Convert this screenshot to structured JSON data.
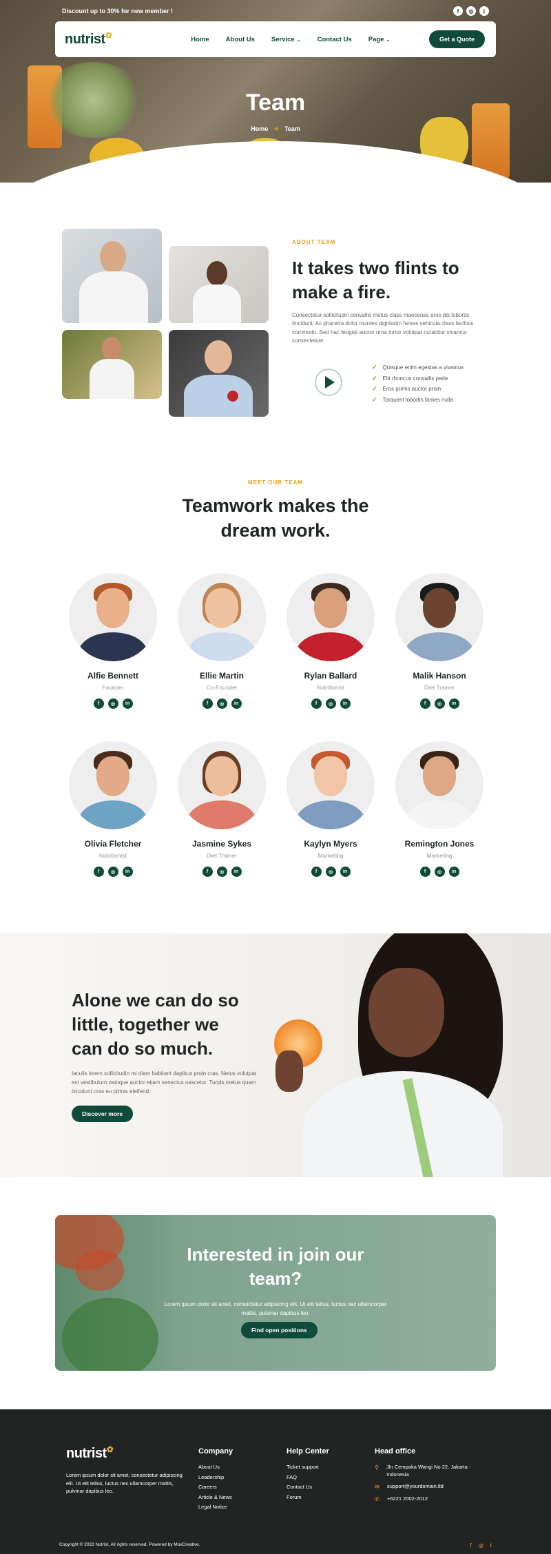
{
  "topbar": {
    "discount": "Discount up to 30% for new member !"
  },
  "brand": {
    "logo": "nutrist",
    "logo_leaf": "✿"
  },
  "nav": {
    "items": [
      "Home",
      "About Us",
      "Service",
      "Contact Us",
      "Page"
    ],
    "service_chevron": "⌄",
    "page_chevron": "⌄",
    "cta": "Get a Quote"
  },
  "hero": {
    "title": "Team",
    "breadcrumb_home": "Home",
    "breadcrumb_arrow": "➔",
    "breadcrumb_current": "Team"
  },
  "about": {
    "eyebrow": "ABOUT TEAM",
    "title": "It takes two flints to make a fire.",
    "text": "Consectetur sollicitudin convallis metus class maecenas eros dis lobortis tincidunt. Ac pharetra dolor montes dignissim fames vehicula class facilisis commodo. Sed hac feugiat auctor urna tortor volutpat curabitur vivamus consectetuer.",
    "checklist": [
      "Quisque enim egestas a vivamus",
      "Elit rhoncus convallis pede",
      "Eros primis auctor proin",
      "Torquent lobortis fames nulla"
    ]
  },
  "team": {
    "eyebrow": "MEET OUR TEAM",
    "title": "Teamwork makes the dream work.",
    "members": [
      {
        "name": "Alfie Bennett",
        "role": "Founder"
      },
      {
        "name": "Ellie Martin",
        "role": "Co-Founder"
      },
      {
        "name": "Rylan Ballard",
        "role": "Nutritionist"
      },
      {
        "name": "Malik Hanson",
        "role": "Diet Trainer"
      },
      {
        "name": "Olivia Fletcher",
        "role": "Nutritionist"
      },
      {
        "name": "Jasmine Sykes",
        "role": "Diet Trainer"
      },
      {
        "name": "Kaylyn Myers",
        "role": "Marketing"
      },
      {
        "name": "Remington Jones",
        "role": "Marketing"
      }
    ]
  },
  "banner": {
    "title": "Alone we can do so little, together we can do so much.",
    "text": "Iaculis lorem sollicitudin mi diam habitant dapibus proin cras. Netus volutpat est vestibulum natoque auctor etiam senectus nascetur. Turpis metus quam tincidunt cras eu primis eleifend.",
    "button": "Discover more"
  },
  "cta": {
    "title": "Interested in join our team?",
    "text": "Lorem ipsum dolor sit amet, consectetur adipiscing elit. Ut elit tellus, luctus nec ullamcorper mattis, pulvinar dapibus leo.",
    "button": "Find open positions"
  },
  "footer": {
    "about": "Lorem ipsum dolor sit amet, consectetur adipiscing elit. Ut elit tellus, luctus nec ullamcorper mattis, pulvinar dapibus leo.",
    "company": {
      "title": "Company",
      "items": [
        "About Us",
        "Leadership",
        "Careers",
        "Article & News",
        "Legal Notice"
      ]
    },
    "help": {
      "title": "Help Center",
      "items": [
        "Ticket support",
        "FAQ",
        "Contact Us",
        "Forum"
      ]
    },
    "office": {
      "title": "Head office",
      "address": "Jln Cempaka Wangi No 22, Jakarta - Indonesia",
      "email": "support@yourdomain.tld",
      "phone": "+6221 2002-2012"
    },
    "copyright": "Copyright © 2022 Nutrist, All rights reserved. Powered by MoxCreative."
  },
  "colors": {
    "brand_green": "#0f4a3a",
    "accent_orange": "#e8a220",
    "footer_bg": "#222424"
  },
  "icons": {
    "facebook": "facebook-icon",
    "instagram": "instagram-icon",
    "twitter": "twitter-icon",
    "linkedin": "linkedin-icon",
    "play": "play-icon",
    "check": "check-icon",
    "location": "location-icon",
    "mail": "mail-icon",
    "phone": "phone-icon"
  }
}
